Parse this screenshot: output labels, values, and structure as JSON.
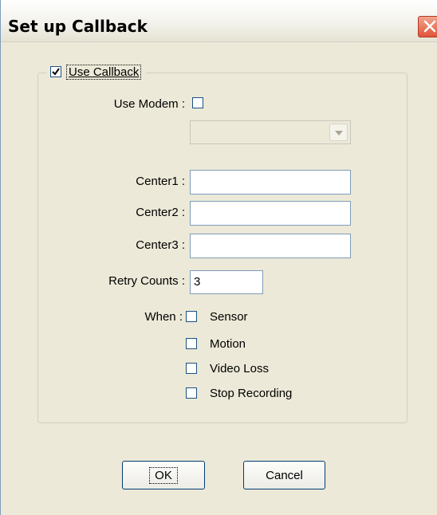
{
  "window": {
    "title": "Set up Callback",
    "close_icon": "close-icon"
  },
  "group": {
    "legend_label": "Use Callback",
    "checked": true
  },
  "modem": {
    "label": "Use Modem :",
    "checked": false,
    "select_value": ""
  },
  "centers": [
    {
      "label": "Center1 :",
      "value": ""
    },
    {
      "label": "Center2 :",
      "value": ""
    },
    {
      "label": "Center3 :",
      "value": ""
    }
  ],
  "retry": {
    "label": "Retry Counts :",
    "value": "3"
  },
  "when": {
    "label": "When :",
    "options": [
      {
        "label": "Sensor",
        "checked": false
      },
      {
        "label": "Motion",
        "checked": false
      },
      {
        "label": "Video Loss",
        "checked": false
      },
      {
        "label": "Stop Recording",
        "checked": false
      }
    ]
  },
  "buttons": {
    "ok_label": "OK",
    "cancel_label": "Cancel"
  },
  "colors": {
    "dialog_bg": "#ece9d8",
    "field_border": "#7f9db9",
    "close_red": "#e0543a"
  }
}
